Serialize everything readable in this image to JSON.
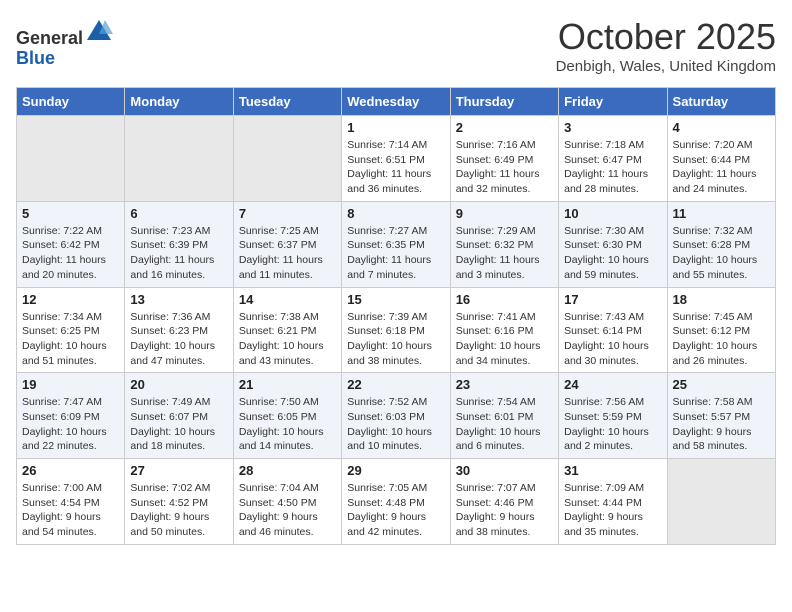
{
  "header": {
    "logo_general": "General",
    "logo_blue": "Blue",
    "month_title": "October 2025",
    "location": "Denbigh, Wales, United Kingdom"
  },
  "days_of_week": [
    "Sunday",
    "Monday",
    "Tuesday",
    "Wednesday",
    "Thursday",
    "Friday",
    "Saturday"
  ],
  "weeks": [
    [
      {
        "day": "",
        "empty": true
      },
      {
        "day": "",
        "empty": true
      },
      {
        "day": "",
        "empty": true
      },
      {
        "day": "1",
        "sunrise": "7:14 AM",
        "sunset": "6:51 PM",
        "daylight": "11 hours and 36 minutes."
      },
      {
        "day": "2",
        "sunrise": "7:16 AM",
        "sunset": "6:49 PM",
        "daylight": "11 hours and 32 minutes."
      },
      {
        "day": "3",
        "sunrise": "7:18 AM",
        "sunset": "6:47 PM",
        "daylight": "11 hours and 28 minutes."
      },
      {
        "day": "4",
        "sunrise": "7:20 AM",
        "sunset": "6:44 PM",
        "daylight": "11 hours and 24 minutes."
      }
    ],
    [
      {
        "day": "5",
        "sunrise": "7:22 AM",
        "sunset": "6:42 PM",
        "daylight": "11 hours and 20 minutes."
      },
      {
        "day": "6",
        "sunrise": "7:23 AM",
        "sunset": "6:39 PM",
        "daylight": "11 hours and 16 minutes."
      },
      {
        "day": "7",
        "sunrise": "7:25 AM",
        "sunset": "6:37 PM",
        "daylight": "11 hours and 11 minutes."
      },
      {
        "day": "8",
        "sunrise": "7:27 AM",
        "sunset": "6:35 PM",
        "daylight": "11 hours and 7 minutes."
      },
      {
        "day": "9",
        "sunrise": "7:29 AM",
        "sunset": "6:32 PM",
        "daylight": "11 hours and 3 minutes."
      },
      {
        "day": "10",
        "sunrise": "7:30 AM",
        "sunset": "6:30 PM",
        "daylight": "10 hours and 59 minutes."
      },
      {
        "day": "11",
        "sunrise": "7:32 AM",
        "sunset": "6:28 PM",
        "daylight": "10 hours and 55 minutes."
      }
    ],
    [
      {
        "day": "12",
        "sunrise": "7:34 AM",
        "sunset": "6:25 PM",
        "daylight": "10 hours and 51 minutes."
      },
      {
        "day": "13",
        "sunrise": "7:36 AM",
        "sunset": "6:23 PM",
        "daylight": "10 hours and 47 minutes."
      },
      {
        "day": "14",
        "sunrise": "7:38 AM",
        "sunset": "6:21 PM",
        "daylight": "10 hours and 43 minutes."
      },
      {
        "day": "15",
        "sunrise": "7:39 AM",
        "sunset": "6:18 PM",
        "daylight": "10 hours and 38 minutes."
      },
      {
        "day": "16",
        "sunrise": "7:41 AM",
        "sunset": "6:16 PM",
        "daylight": "10 hours and 34 minutes."
      },
      {
        "day": "17",
        "sunrise": "7:43 AM",
        "sunset": "6:14 PM",
        "daylight": "10 hours and 30 minutes."
      },
      {
        "day": "18",
        "sunrise": "7:45 AM",
        "sunset": "6:12 PM",
        "daylight": "10 hours and 26 minutes."
      }
    ],
    [
      {
        "day": "19",
        "sunrise": "7:47 AM",
        "sunset": "6:09 PM",
        "daylight": "10 hours and 22 minutes."
      },
      {
        "day": "20",
        "sunrise": "7:49 AM",
        "sunset": "6:07 PM",
        "daylight": "10 hours and 18 minutes."
      },
      {
        "day": "21",
        "sunrise": "7:50 AM",
        "sunset": "6:05 PM",
        "daylight": "10 hours and 14 minutes."
      },
      {
        "day": "22",
        "sunrise": "7:52 AM",
        "sunset": "6:03 PM",
        "daylight": "10 hours and 10 minutes."
      },
      {
        "day": "23",
        "sunrise": "7:54 AM",
        "sunset": "6:01 PM",
        "daylight": "10 hours and 6 minutes."
      },
      {
        "day": "24",
        "sunrise": "7:56 AM",
        "sunset": "5:59 PM",
        "daylight": "10 hours and 2 minutes."
      },
      {
        "day": "25",
        "sunrise": "7:58 AM",
        "sunset": "5:57 PM",
        "daylight": "9 hours and 58 minutes."
      }
    ],
    [
      {
        "day": "26",
        "sunrise": "7:00 AM",
        "sunset": "4:54 PM",
        "daylight": "9 hours and 54 minutes."
      },
      {
        "day": "27",
        "sunrise": "7:02 AM",
        "sunset": "4:52 PM",
        "daylight": "9 hours and 50 minutes."
      },
      {
        "day": "28",
        "sunrise": "7:04 AM",
        "sunset": "4:50 PM",
        "daylight": "9 hours and 46 minutes."
      },
      {
        "day": "29",
        "sunrise": "7:05 AM",
        "sunset": "4:48 PM",
        "daylight": "9 hours and 42 minutes."
      },
      {
        "day": "30",
        "sunrise": "7:07 AM",
        "sunset": "4:46 PM",
        "daylight": "9 hours and 38 minutes."
      },
      {
        "day": "31",
        "sunrise": "7:09 AM",
        "sunset": "4:44 PM",
        "daylight": "9 hours and 35 minutes."
      },
      {
        "day": "",
        "empty": true
      }
    ]
  ]
}
